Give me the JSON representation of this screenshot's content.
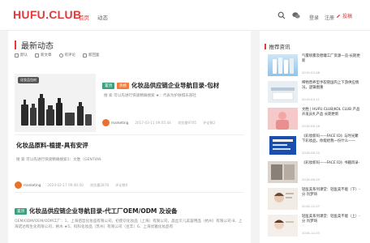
{
  "header": {
    "logo": "HUFU.CLUB",
    "nav": [
      {
        "label": "首页",
        "active": true
      },
      {
        "label": "动态",
        "active": false
      }
    ],
    "login": "登录",
    "register": "注册",
    "post": "投稿"
  },
  "main": {
    "title": "最新动态",
    "filters": [
      "默认",
      "新文章",
      "有评论",
      "新回复"
    ],
    "posts": [
      {
        "thumb_badge": "化妆品包材",
        "tags": [
          "置顶",
          "热榜"
        ],
        "title": "化妆品供应链企业导航目录-包材",
        "excerpt": "搜 索  可以先进行快速精确搜索 ★：代表为护肤俱乐部社",
        "author": "marketing",
        "date": "2017-03-11 09:05:44",
        "views": "浏览量9705",
        "comments": "评论数2"
      },
      {
        "title": "化妆品原料-植提-具有安评",
        "excerpt": "搜 索  可以先进行快速精确搜索1：文胜（GENTIAN",
        "author": "marketing",
        "date": "2024-02-17 09:40:50",
        "views": "浏览量2878",
        "comments": "评论数0"
      },
      {
        "tags": [
          "置顶"
        ],
        "title": "化妆品供应链企业导航目录-代工厂OEM/ODM 及设备",
        "excerpt": "OEM/ODM/OEM/ODM工厂：1、上海佰哲化妆品有限公司，初使识化妆品（上海）有限公司，晶丝贝儿美容用品（杭州）有限公司-8、上海诺达和生化有限公司，格水 ★5、科科化妆品（苏州）有限公司（豆丰）6、上海优雅化妆品有"
      }
    ]
  },
  "sidebar": {
    "title": "推荐资讯",
    "items": [
      {
        "title": "气雾喷雾及稳罐工厂资源一览-长期更新",
        "date": "2019-03-08"
      },
      {
        "title": "稀物营养型手软管国内上下游供应情况，逻辑图重",
        "date": "2019-03-11"
      },
      {
        "title": "文胜 | HUFU.CLUB|KOL CLUB 产品开发员扎产品 长期更新",
        "date": "2018-06-16"
      },
      {
        "title": "《彩妆新码——FACE ID》与时光聚下彩妆品，你能给我一份什么——",
        "date": "2018-06-20"
      },
      {
        "title": "《彩妆新码——FACE ID》书籍目录-",
        "date": "2018-06-20"
      },
      {
        "title": "轻医美系列课堂：轻医美不能（下）- 分 肖梦琦",
        "date": "2018-12-07"
      },
      {
        "title": "轻医美系列课堂：轻医美不能（上）- 分 肖梦琦",
        "date": "2018-12-03"
      }
    ]
  },
  "colors": {
    "accent": "#e23a3a",
    "tag_green": "#3aa17e",
    "tag_orange": "#f07c3e"
  }
}
